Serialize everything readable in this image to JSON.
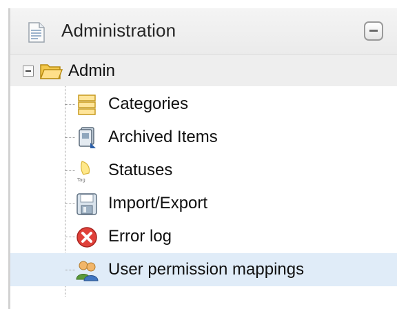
{
  "panel": {
    "title": "Administration",
    "collapse_icon": "minus-box-icon",
    "title_icon": "document-icon"
  },
  "tree": {
    "root": {
      "label": "Admin",
      "icon": "folder-open-icon",
      "expanded": true
    },
    "items": [
      {
        "label": "Categories",
        "icon": "categories-icon",
        "selected": false
      },
      {
        "label": "Archived Items",
        "icon": "archive-icon",
        "selected": false
      },
      {
        "label": "Statuses",
        "icon": "tag-icon",
        "selected": false
      },
      {
        "label": "Import/Export",
        "icon": "floppy-disk-icon",
        "selected": false
      },
      {
        "label": "Error log",
        "icon": "error-icon",
        "selected": false
      },
      {
        "label": "User permission mappings",
        "icon": "users-icon",
        "selected": true
      }
    ]
  },
  "colors": {
    "header_bg": "#efefef",
    "selected_row": "#e0ecf8",
    "text": "#111111"
  }
}
